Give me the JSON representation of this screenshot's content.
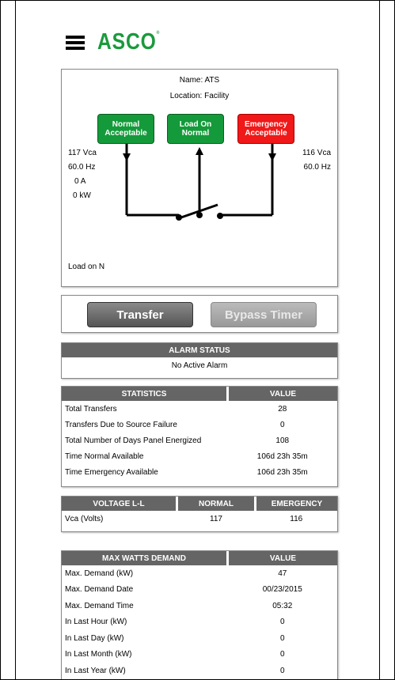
{
  "header": {
    "logo": "ASCO",
    "reg": "®"
  },
  "diagram": {
    "name": "Name: ATS",
    "location": "Location: Facility",
    "buttons": [
      {
        "label": "Normal Acceptable",
        "color": "#149a3a"
      },
      {
        "label": "Load On Normal",
        "color": "#149a3a"
      },
      {
        "label": "Emergency Acceptable",
        "color": "#f01818"
      }
    ],
    "normal_source": {
      "voltage": "117 Vca",
      "frequency": "60.0 Hz",
      "current": "0 A",
      "power": "0 kW"
    },
    "emergency_source": {
      "voltage": "116 Vca",
      "frequency": "60.0 Hz"
    },
    "load_status": "Load on N"
  },
  "actions": {
    "transfer": "Transfer",
    "bypass": "Bypass Timer"
  },
  "alarm": {
    "header": "ALARM STATUS",
    "status": "No Active Alarm"
  },
  "statistics": {
    "headers": [
      "STATISTICS",
      "VALUE"
    ],
    "rows": [
      [
        "Total Transfers",
        "28"
      ],
      [
        "Transfers Due to Source Failure",
        "0"
      ],
      [
        "Total Number of Days Panel Energized",
        "108"
      ],
      [
        "Time Normal Available",
        "106d 23h 35m"
      ],
      [
        "Time Emergency Available",
        "106d 23h 35m"
      ]
    ]
  },
  "voltage": {
    "headers": [
      "VOLTAGE L-L",
      "NORMAL",
      "EMERGENCY"
    ],
    "rows": [
      [
        "Vca (Volts)",
        "117",
        "116"
      ]
    ]
  },
  "watts": {
    "headers": [
      "MAX WATTS DEMAND",
      "VALUE"
    ],
    "rows": [
      [
        "Max. Demand (kW)",
        "47"
      ],
      [
        "Max. Demand Date",
        "00/23/2015"
      ],
      [
        "Max. Demand Time",
        "05:32"
      ],
      [
        "In Last Hour (kW)",
        "0"
      ],
      [
        "In Last Day (kW)",
        "0"
      ],
      [
        "In Last Month (kW)",
        "0"
      ],
      [
        "In Last Year (kW)",
        "0"
      ]
    ]
  }
}
